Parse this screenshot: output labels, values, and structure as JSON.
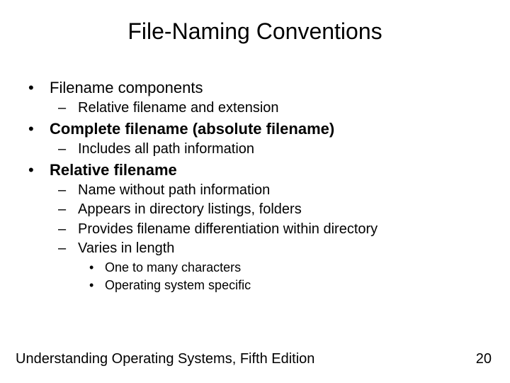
{
  "title": "File-Naming Conventions",
  "bullets": {
    "b1": "Filename components",
    "b1_1": "Relative filename and extension",
    "b2": "Complete filename (absolute filename)",
    "b2_1": "Includes all path information",
    "b3": "Relative filename",
    "b3_1": "Name without path information",
    "b3_2": "Appears in directory listings, folders",
    "b3_3": "Provides filename differentiation within directory",
    "b3_4": "Varies in length",
    "b3_4_1": "One to many characters",
    "b3_4_2": "Operating system specific"
  },
  "footer": {
    "left": "Understanding Operating Systems, Fifth Edition",
    "right": "20"
  }
}
